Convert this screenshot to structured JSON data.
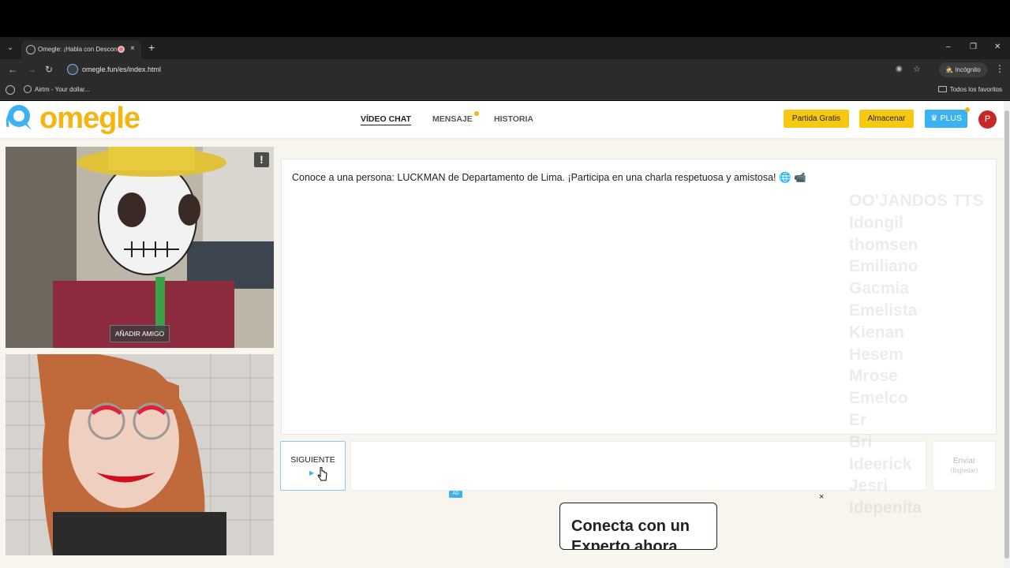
{
  "browser": {
    "tab_title": "Omegle: ¡Habla con Descon",
    "tab_close": "×",
    "new_tab": "+",
    "url": "omegle.fun/es/index.html",
    "incognito_label": "Incógnito",
    "bookmark_item": "Airtm - Your dollar...",
    "all_bookmarks": "Todos los favoritos",
    "window_controls": [
      "–",
      "❐",
      "✕"
    ]
  },
  "site": {
    "logo_text": "omegle",
    "nav": [
      {
        "label": "VÍDEO CHAT",
        "active": true
      },
      {
        "label": "MENSAJE",
        "active": false
      },
      {
        "label": "HISTORIA",
        "active": false
      }
    ],
    "buttons": {
      "free_game": "Partida Gratis",
      "store": "Almacenar",
      "plus": "♛ PLUS",
      "avatar_initial": "P"
    },
    "colors": {
      "brand_yellow": "#f5b40f",
      "plus_blue": "#3cb3f0",
      "avatar_red": "#c62828"
    }
  },
  "video": {
    "report_label": "!",
    "add_friend_label": "AÑADIR AMIGO"
  },
  "chat": {
    "intro_message": "Conoce a una persona: LUCKMAN de Departamento de Lima. ¡Participa en una charla respetuosa y amistosa! 🌐 📹",
    "next_button": "SIGUIENTE",
    "next_sub": "▶",
    "send_button": "Enviar",
    "send_sub": "(Ingresar)",
    "input_value": ""
  },
  "sidebar_names": [
    "OO'JANDOS TTS",
    "Idongil",
    "thomsen",
    "Emiliano",
    "Gacmia",
    "Emelista",
    "Kienan",
    "Hesem",
    "Mrose",
    "Emelco",
    "Er",
    "Bri",
    "Ideerick",
    "Jesri",
    "Idepenita"
  ],
  "ad": {
    "badge": "AD",
    "close": "×",
    "headline": "Conecta con un Experto ahora"
  }
}
